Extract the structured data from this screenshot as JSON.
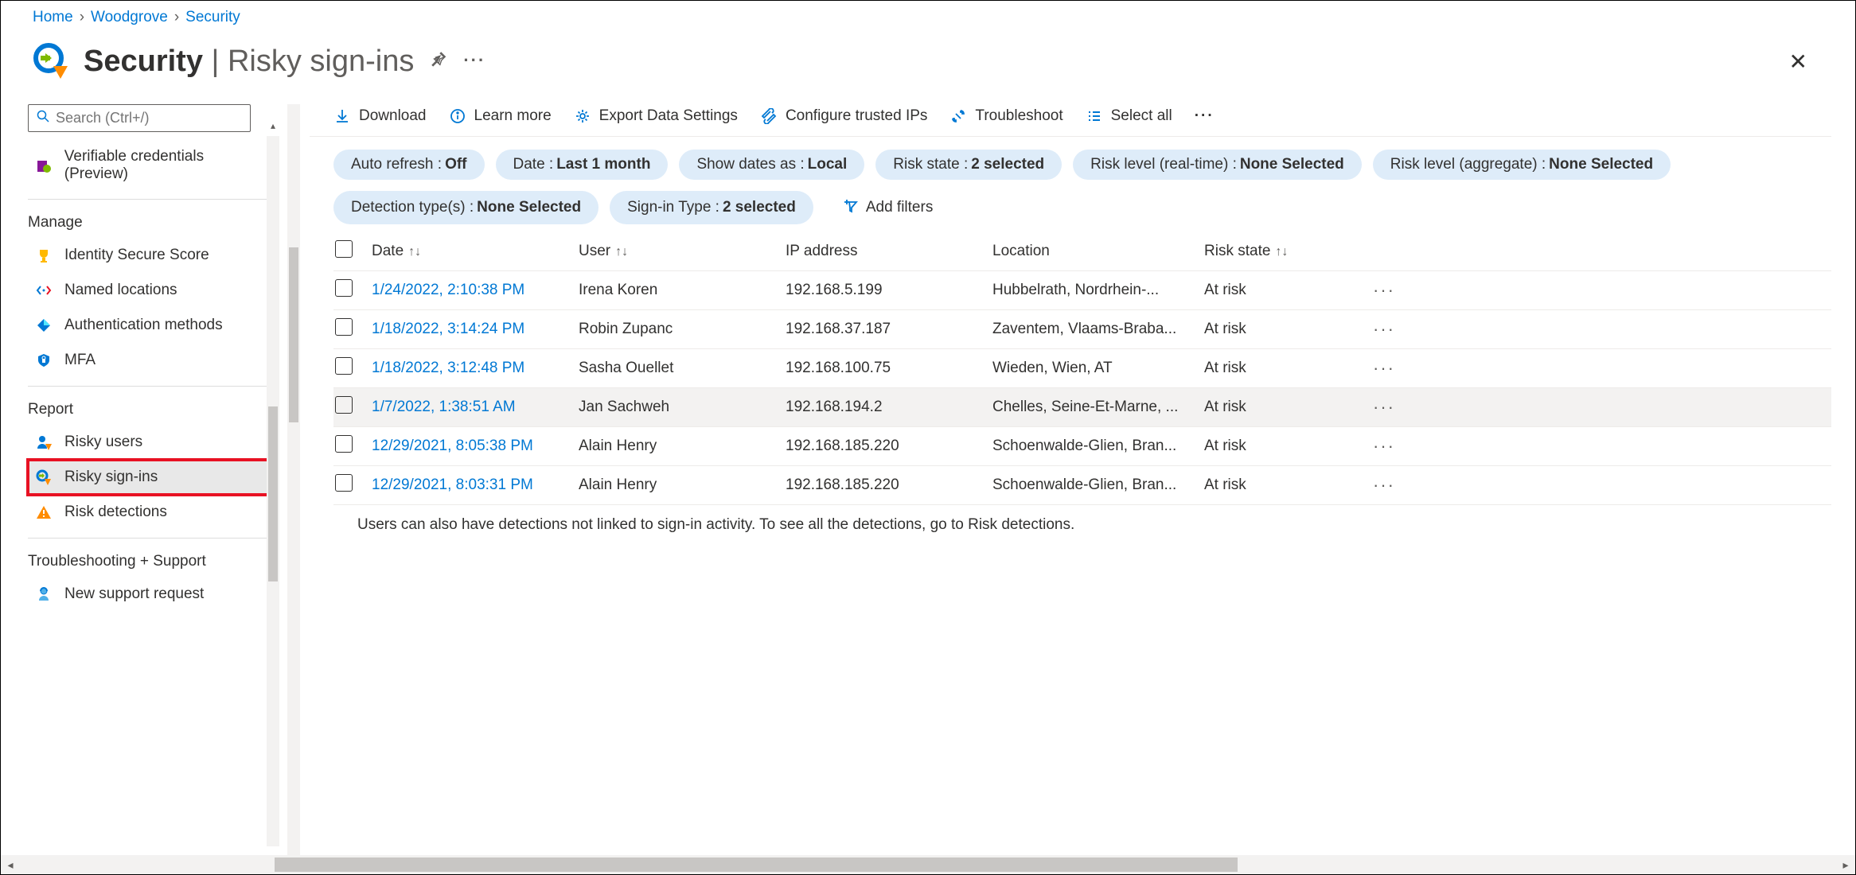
{
  "breadcrumb": [
    "Home",
    "Woodgrove",
    "Security"
  ],
  "header": {
    "title": "Security",
    "subtitle": "Risky sign-ins"
  },
  "search": {
    "placeholder": "Search (Ctrl+/)"
  },
  "sidebar": {
    "top_item": "Verifiable credentials (Preview)",
    "sections": [
      {
        "title": "Manage",
        "items": [
          {
            "label": "Identity Secure Score"
          },
          {
            "label": "Named locations"
          },
          {
            "label": "Authentication methods"
          },
          {
            "label": "MFA"
          }
        ]
      },
      {
        "title": "Report",
        "items": [
          {
            "label": "Risky users"
          },
          {
            "label": "Risky sign-ins",
            "active": true
          },
          {
            "label": "Risk detections"
          }
        ]
      },
      {
        "title": "Troubleshooting + Support",
        "items": [
          {
            "label": "New support request"
          }
        ]
      }
    ]
  },
  "toolbar": {
    "download": "Download",
    "learn_more": "Learn more",
    "export": "Export Data Settings",
    "trusted_ips": "Configure trusted IPs",
    "troubleshoot": "Troubleshoot",
    "select_all": "Select all"
  },
  "filters": [
    {
      "label": "Auto refresh : ",
      "value": "Off"
    },
    {
      "label": "Date : ",
      "value": "Last 1 month"
    },
    {
      "label": "Show dates as : ",
      "value": "Local"
    },
    {
      "label": "Risk state : ",
      "value": "2 selected"
    },
    {
      "label": "Risk level (real-time) : ",
      "value": "None Selected"
    },
    {
      "label": "Risk level (aggregate) : ",
      "value": "None Selected"
    },
    {
      "label": "Detection type(s) : ",
      "value": "None Selected"
    },
    {
      "label": "Sign-in Type : ",
      "value": "2 selected"
    }
  ],
  "add_filters": "Add filters",
  "columns": {
    "date": "Date",
    "user": "User",
    "ip": "IP address",
    "location": "Location",
    "risk": "Risk state"
  },
  "rows": [
    {
      "date": "1/24/2022, 2:10:38 PM",
      "user": "Irena Koren",
      "ip": "192.168.5.199",
      "location": "Hubbelrath, Nordrhein-...",
      "risk": "At risk"
    },
    {
      "date": "1/18/2022, 3:14:24 PM",
      "user": "Robin Zupanc",
      "ip": "192.168.37.187",
      "location": "Zaventem, Vlaams-Braba...",
      "risk": "At risk"
    },
    {
      "date": "1/18/2022, 3:12:48 PM",
      "user": "Sasha Ouellet",
      "ip": "192.168.100.75",
      "location": "Wieden, Wien, AT",
      "risk": "At risk"
    },
    {
      "date": "1/7/2022, 1:38:51 AM",
      "user": "Jan Sachweh",
      "ip": "192.168.194.2",
      "location": "Chelles, Seine-Et-Marne, ...",
      "risk": "At risk",
      "hover": true
    },
    {
      "date": "12/29/2021, 8:05:38 PM",
      "user": "Alain Henry",
      "ip": "192.168.185.220",
      "location": "Schoenwalde-Glien, Bran...",
      "risk": "At risk"
    },
    {
      "date": "12/29/2021, 8:03:31 PM",
      "user": "Alain Henry",
      "ip": "192.168.185.220",
      "location": "Schoenwalde-Glien, Bran...",
      "risk": "At risk"
    }
  ],
  "footer": "Users can also have detections not linked to sign-in activity. To see all the detections, go to Risk detections."
}
